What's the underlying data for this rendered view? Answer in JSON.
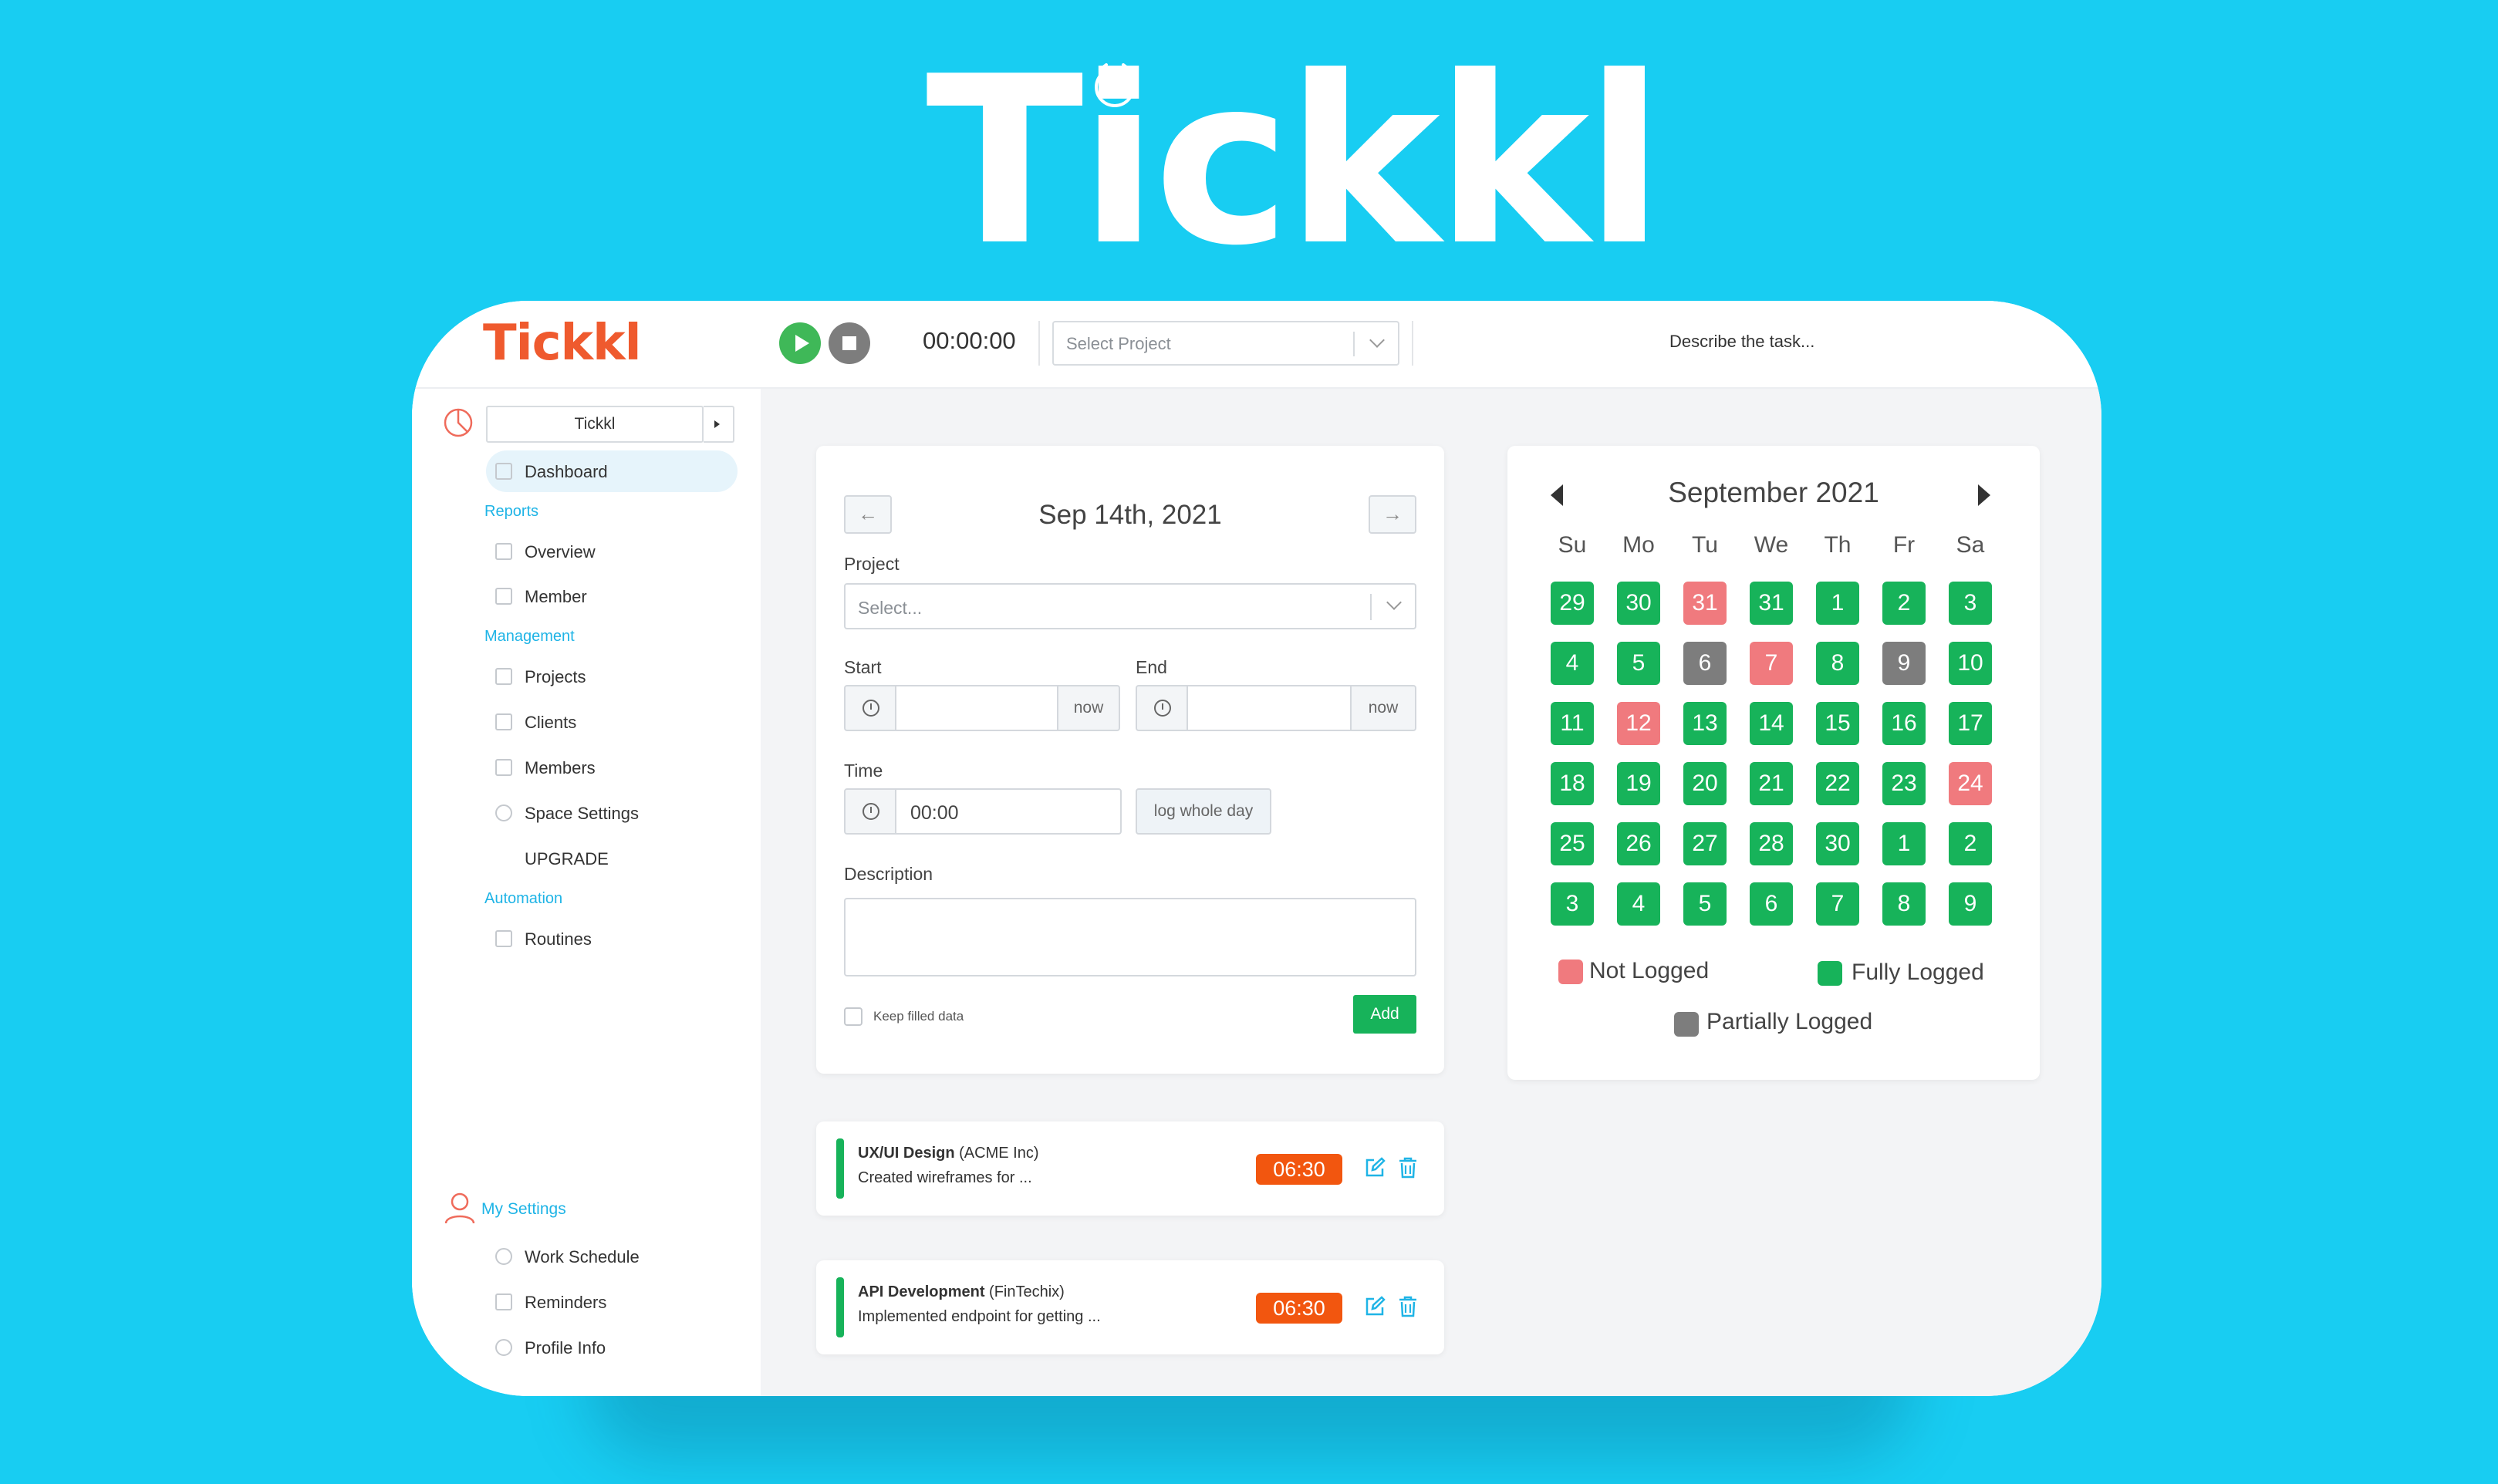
{
  "brand": {
    "hero_logo": "Tickkl",
    "app_logo": "Tickkl"
  },
  "colors": {
    "background": "#18cdf2",
    "logged": "#17b35a",
    "not_logged": "#f07a7e",
    "partial": "#7d7d7d",
    "badge": "#f2560f",
    "accent": "#1fb4e6"
  },
  "topbar": {
    "timer": "00:00:00",
    "project_placeholder": "Select Project",
    "task_placeholder": "Describe the task..."
  },
  "sidebar": {
    "space_name": "Tickkl",
    "dashboard": "Dashboard",
    "reports_label": "Reports",
    "overview": "Overview",
    "member": "Member",
    "management_label": "Management",
    "projects": "Projects",
    "clients": "Clients",
    "members": "Members",
    "space_settings": "Space Settings",
    "upgrade": "UPGRADE",
    "automation_label": "Automation",
    "routines": "Routines",
    "my_settings_label": "My Settings",
    "work_schedule": "Work Schedule",
    "reminders": "Reminders",
    "profile_info": "Profile Info"
  },
  "form": {
    "date": "Sep 14th, 2021",
    "project_label": "Project",
    "project_placeholder": "Select...",
    "start_label": "Start",
    "end_label": "End",
    "now_label": "now",
    "time_label": "Time",
    "time_value": "00:00",
    "log_whole_day": "log whole day",
    "description_label": "Description",
    "keep_filled": "Keep filled data",
    "add": "Add"
  },
  "entries": [
    {
      "project": "UX/UI Design",
      "client": "(ACME Inc)",
      "description": "Created wireframes for ...",
      "duration": "06:30"
    },
    {
      "project": "API Development",
      "client": "(FinTechix)",
      "description": "Implemented endpoint for getting ...",
      "duration": "06:30"
    }
  ],
  "calendar": {
    "title": "September 2021",
    "weekdays": [
      "Su",
      "Mo",
      "Tu",
      "We",
      "Th",
      "Fr",
      "Sa"
    ],
    "weeks": [
      [
        [
          "29",
          "logged"
        ],
        [
          "30",
          "logged"
        ],
        [
          "31",
          "not"
        ],
        [
          "31",
          "logged"
        ],
        [
          "1",
          "logged"
        ],
        [
          "2",
          "logged"
        ],
        [
          "3",
          "logged"
        ]
      ],
      [
        [
          "4",
          "logged"
        ],
        [
          "5",
          "logged"
        ],
        [
          "6",
          "partial"
        ],
        [
          "7",
          "not"
        ],
        [
          "8",
          "logged"
        ],
        [
          "9",
          "partial"
        ],
        [
          "10",
          "logged"
        ]
      ],
      [
        [
          "11",
          "logged"
        ],
        [
          "12",
          "not"
        ],
        [
          "13",
          "logged"
        ],
        [
          "14",
          "logged"
        ],
        [
          "15",
          "logged"
        ],
        [
          "16",
          "logged"
        ],
        [
          "17",
          "logged"
        ]
      ],
      [
        [
          "18",
          "logged"
        ],
        [
          "19",
          "logged"
        ],
        [
          "20",
          "logged"
        ],
        [
          "21",
          "logged"
        ],
        [
          "22",
          "logged"
        ],
        [
          "23",
          "logged"
        ],
        [
          "24",
          "not"
        ]
      ],
      [
        [
          "25",
          "logged"
        ],
        [
          "26",
          "logged"
        ],
        [
          "27",
          "logged"
        ],
        [
          "28",
          "logged"
        ],
        [
          "30",
          "logged"
        ],
        [
          "1",
          "logged"
        ],
        [
          "2",
          "logged"
        ]
      ],
      [
        [
          "3",
          "logged"
        ],
        [
          "4",
          "logged"
        ],
        [
          "5",
          "logged"
        ],
        [
          "6",
          "logged"
        ],
        [
          "7",
          "logged"
        ],
        [
          "8",
          "logged"
        ],
        [
          "9",
          "logged"
        ]
      ]
    ],
    "legend": {
      "not_logged": "Not Logged",
      "fully_logged": "Fully Logged",
      "partially_logged": "Partially Logged"
    }
  }
}
